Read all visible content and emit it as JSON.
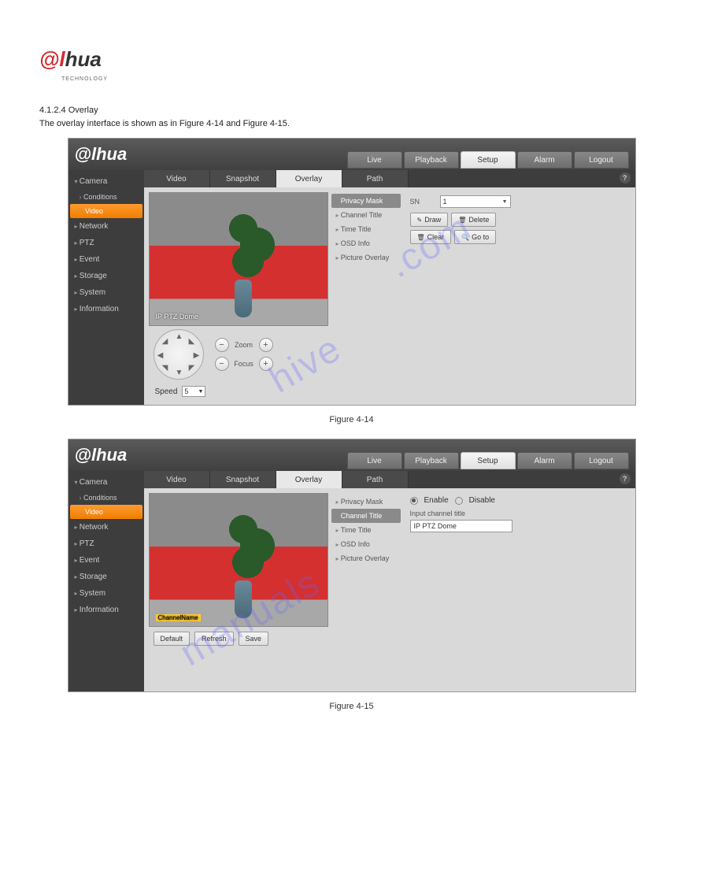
{
  "brand": {
    "at": "@",
    "l": "l",
    "hua": "hua",
    "sub": "TECHNOLOGY"
  },
  "intro": {
    "line1": "4.1.2.4 Overlay",
    "line2": "The overlay interface is shown as in Figure 4-14 and Figure 4-15."
  },
  "topTabs": [
    "Live",
    "Playback",
    "Setup",
    "Alarm",
    "Logout"
  ],
  "topActive": "Setup",
  "sidebar": {
    "head": "Camera",
    "subs": [
      "Conditions",
      "Video"
    ],
    "subActive": "Video",
    "items": [
      "Network",
      "PTZ",
      "Event",
      "Storage",
      "System",
      "Information"
    ]
  },
  "subTabs": [
    "Video",
    "Snapshot",
    "Overlay",
    "Path"
  ],
  "subActive": "Overlay",
  "overlayItems": [
    "Privacy Mask",
    "Channel Title",
    "Time Title",
    "OSD Info",
    "Picture Overlay"
  ],
  "fig1": {
    "activeItem": "Privacy Mask",
    "previewText": "IP PTZ Dome",
    "snLabel": "SN",
    "snValue": "1",
    "buttons": {
      "draw": "Draw",
      "delete": "Delete",
      "clear": "Clear",
      "goto": "Go to"
    },
    "zoom": "Zoom",
    "focus": "Focus",
    "speedLabel": "Speed",
    "speedValue": "5",
    "caption": "Figure 4-14"
  },
  "fig2": {
    "activeItem": "Channel Title",
    "previewBoxText": "ChannelName",
    "enable": "Enable",
    "disable": "Disable",
    "inputLabel": "Input channel title",
    "inputValue": "IP PTZ Dome",
    "buttons": {
      "default": "Default",
      "refresh": "Refresh",
      "save": "Save"
    },
    "caption": "Figure 4-15"
  },
  "watermark": "manualshive.com"
}
